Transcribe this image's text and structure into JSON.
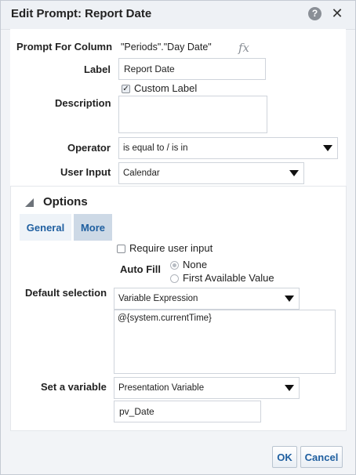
{
  "dialog": {
    "title": "Edit Prompt: Report Date",
    "help_icon": "help-icon",
    "help_glyph": "?",
    "close_icon": "close-icon",
    "close_glyph": "✕"
  },
  "form": {
    "prompt_for_column_label": "Prompt For Column",
    "prompt_for_column_value": "\"Periods\".\"Day Date\"",
    "fx_icon": "fx-icon",
    "fx_glyph": "fx",
    "label_label": "Label",
    "label_value": "Report Date",
    "custom_label_text": "Custom Label",
    "custom_label_checked": true,
    "check_glyph": "✓",
    "description_label": "Description",
    "description_value": "",
    "operator_label": "Operator",
    "operator_value": "is equal to / is in",
    "user_input_label": "User Input",
    "user_input_value": "Calendar"
  },
  "options": {
    "title": "Options",
    "collapse_icon": "triangle-icon",
    "tabs": [
      {
        "label": "General",
        "selected": false
      },
      {
        "label": "More",
        "selected": true
      }
    ],
    "require_user_input_text": "Require user input",
    "require_user_input_checked": false,
    "auto_fill_label": "Auto Fill",
    "auto_fill_options": [
      {
        "label": "None",
        "selected": true
      },
      {
        "label": "First Available Value",
        "selected": false
      }
    ],
    "default_selection_label": "Default selection",
    "default_selection_value": "Variable Expression",
    "default_expression": "@{system.currentTime}",
    "set_variable_label": "Set a variable",
    "set_variable_value": "Presentation Variable",
    "variable_name": "pv_Date"
  },
  "buttons": {
    "ok_label": "OK",
    "cancel_label": "Cancel"
  },
  "colors": {
    "accent": "#1f5fa0",
    "tab_selected_bg": "#cdd9e6",
    "dialog_bg": "#f2f4f7"
  }
}
